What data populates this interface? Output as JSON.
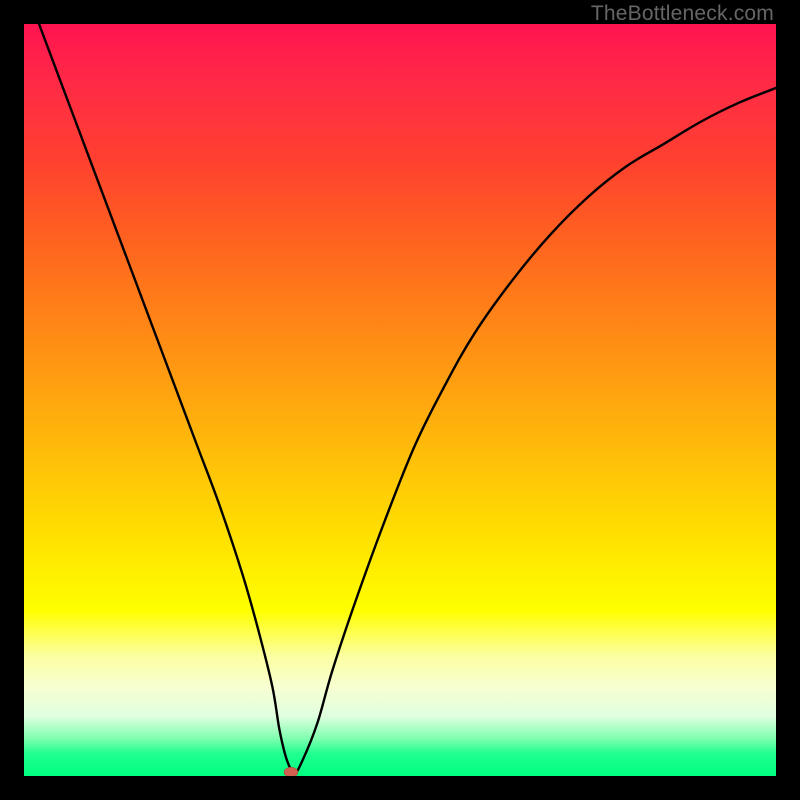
{
  "watermark": "TheBottleneck.com",
  "chart_data": {
    "type": "line",
    "title": "",
    "xlabel": "",
    "ylabel": "",
    "xlim": [
      0,
      100
    ],
    "ylim": [
      0,
      100
    ],
    "grid": false,
    "series": [
      {
        "name": "curve",
        "x": [
          2,
          5,
          8,
          11,
          14,
          17,
          20,
          23,
          26,
          29,
          31,
          33,
          34,
          35,
          36,
          37,
          39,
          41,
          44,
          48,
          52,
          56,
          60,
          65,
          70,
          75,
          80,
          85,
          90,
          95,
          100
        ],
        "y": [
          100,
          92,
          84,
          76,
          68,
          60,
          52,
          44,
          36,
          27,
          20,
          12,
          6,
          2,
          0.5,
          2,
          7,
          14,
          23,
          34,
          44,
          52,
          59,
          66,
          72,
          77,
          81,
          84,
          87,
          89.5,
          91.5
        ]
      }
    ],
    "marker": {
      "x": 35.5,
      "y": 0.5,
      "color": "#d06050"
    },
    "colors": {
      "curve": "#000000",
      "background_top": "#ff1450",
      "background_bottom": "#00ff80",
      "frame": "#000000"
    }
  }
}
